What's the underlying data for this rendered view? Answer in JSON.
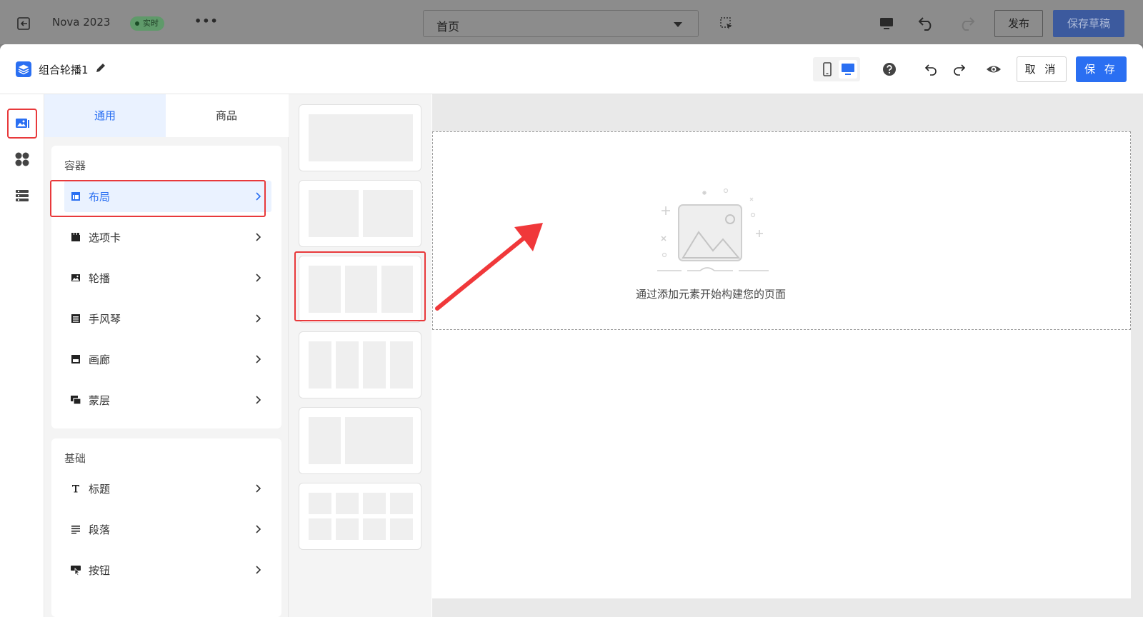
{
  "topbar": {
    "app_name": "Nova 2023",
    "live_badge": "实时",
    "more": "•••",
    "page_select_value": "首页",
    "publish_label": "发布",
    "save_draft_label": "保存草稿"
  },
  "editor": {
    "title": "组合轮播1",
    "cancel_label": "取 消",
    "save_label": "保 存"
  },
  "tabs": [
    "通用",
    "商品"
  ],
  "groups": {
    "container": {
      "title": "容器",
      "items": [
        "布局",
        "选项卡",
        "轮播",
        "手风琴",
        "画廊",
        "蒙层"
      ]
    },
    "basic": {
      "title": "基础",
      "items": [
        "标题",
        "段落",
        "按钮"
      ]
    }
  },
  "canvas": {
    "empty_text": "通过添加元素开始构建您的页面"
  },
  "colors": {
    "accent": "#2a6ff2",
    "highlight": "#e8393b",
    "active_bg": "#eaf2ff"
  },
  "icons": {
    "rail": [
      "image-gallery-icon",
      "components-grid-icon",
      "layers-list-icon"
    ],
    "container": [
      "layout-icon",
      "tabs-icon",
      "carousel-icon",
      "accordion-icon",
      "gallery-icon",
      "overlay-icon"
    ],
    "basic": [
      "title-icon",
      "paragraph-icon",
      "button-icon"
    ]
  }
}
